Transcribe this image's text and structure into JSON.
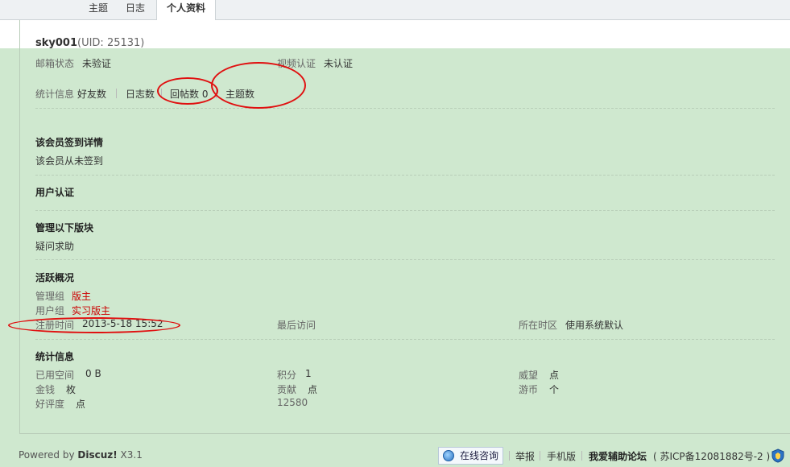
{
  "tabs": [
    {
      "label": "主题",
      "active": false
    },
    {
      "label": "日志",
      "active": false
    },
    {
      "label": "个人资料",
      "active": true
    }
  ],
  "profile": {
    "username": "sky001",
    "uid": "(UID: 25131)",
    "email_status_label": "邮箱状态",
    "email_status_value": "未验证",
    "video_auth_label": "视频认证",
    "video_auth_value": "未认证",
    "stats_label": "统计信息",
    "stats": [
      {
        "label": "好友数",
        "value": ""
      },
      {
        "label": "日志数",
        "value": ""
      },
      {
        "label": "回帖数",
        "value": "0"
      },
      {
        "label": "主题数",
        "value": ""
      }
    ]
  },
  "sections": {
    "signin": {
      "title": "该会员签到详情",
      "text": "该会员从未签到"
    },
    "user_auth": {
      "title": "用户认证"
    },
    "manage": {
      "title": "管理以下版块",
      "text": "疑问求助"
    },
    "activity": {
      "title": "活跃概况",
      "admin_group_label": "管理组",
      "admin_group_value": "版主",
      "user_group_label": "用户组",
      "user_group_value": "实习版主",
      "reg_time_label": "注册时间",
      "reg_time_value": "2013-5-18 15:52",
      "last_visit_label": "最后访问",
      "timezone_label": "所在时区",
      "timezone_value": "使用系统默认"
    },
    "statistics": {
      "title": "统计信息",
      "space_label": "已用空间",
      "space_value": "0 B",
      "points_label": "积分",
      "points_value": "1",
      "prestige_label": "威望",
      "prestige_value": "点",
      "money_label": "金钱",
      "money_value": "枚",
      "contribution_label": "贡献",
      "contribution_value": "点",
      "coins_label": "游币",
      "coins_value": "个",
      "rating_label": "好评度",
      "rating_value": "点",
      "extra_value": "12580"
    }
  },
  "footer": {
    "powered_prefix": "Powered by ",
    "powered_brand": "Discuz!",
    "powered_version": " X3.1",
    "chat_label": "在线咨询",
    "links": [
      "举报",
      "手机版"
    ],
    "site_name": "我爱辅助论坛",
    "icp": "( 苏ICP备12081882号-2 )"
  },
  "colors": {
    "content_bg": "#cfe8cf",
    "annotation": "#e01010",
    "group_value": "#cc0000"
  },
  "icons": [
    "chat-bubble-icon",
    "shield-icon"
  ]
}
